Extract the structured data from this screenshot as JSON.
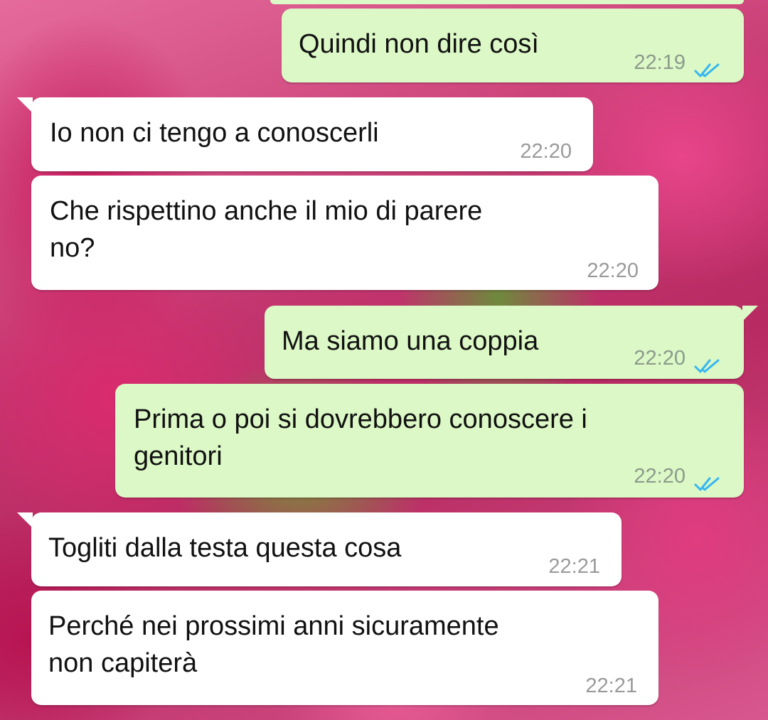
{
  "chat": {
    "messages": [
      {
        "direction": "outgoing",
        "text": "Quindi non dire così",
        "time": "22:19",
        "status": "read"
      },
      {
        "direction": "incoming",
        "text": "Io non ci tengo a conoscerli",
        "time": "22:20"
      },
      {
        "direction": "incoming",
        "text": "Che rispettino anche il mio di parere\nno?",
        "time": "22:20"
      },
      {
        "direction": "outgoing",
        "text": "Ma siamo una coppia",
        "time": "22:20",
        "status": "read"
      },
      {
        "direction": "outgoing",
        "text": "Prima o poi si dovrebbero conoscere i\ngenitori",
        "time": "22:20",
        "status": "read"
      },
      {
        "direction": "incoming",
        "text": "Togliti dalla testa questa cosa",
        "time": "22:21"
      },
      {
        "direction": "incoming",
        "text": "Perché nei prossimi anni sicuramente\nnon capiterà",
        "time": "22:21"
      }
    ]
  },
  "colors": {
    "outgoing_bubble": "#dcf8c6",
    "incoming_bubble": "#ffffff",
    "read_ticks": "#34b7f1"
  },
  "icons": {
    "read_status": "double-check-icon"
  }
}
